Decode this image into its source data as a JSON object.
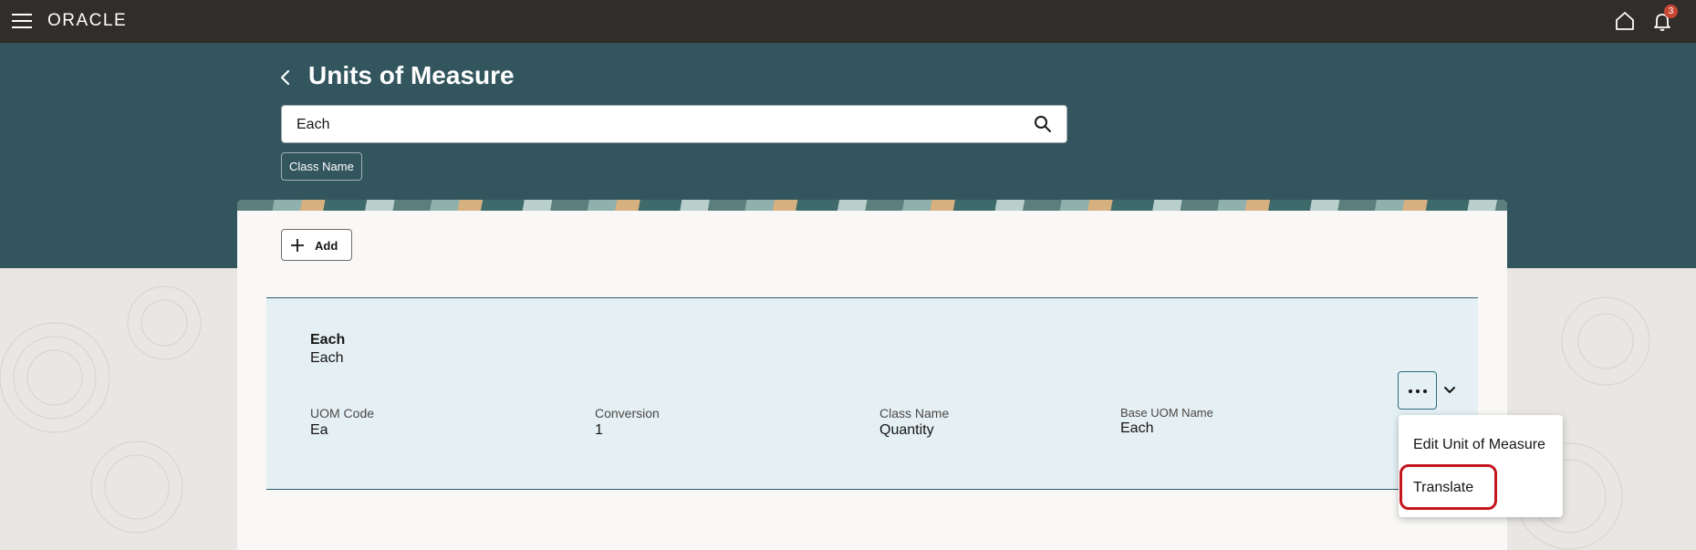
{
  "topbar": {
    "logo": "ORACLE",
    "notification_count": "3",
    "icons": [
      "menu-icon",
      "home-icon",
      "bell-icon"
    ]
  },
  "header": {
    "title": "Units of Measure"
  },
  "search": {
    "value": "Each"
  },
  "filters": {
    "chip_label": "Class Name"
  },
  "toolbar": {
    "add_label": "Add"
  },
  "record": {
    "title": "Each",
    "subtitle": "Each",
    "fields": [
      {
        "label": "UOM Code",
        "value": "Ea"
      },
      {
        "label": "Conversion",
        "value": "1"
      },
      {
        "label": "Class Name",
        "value": "Quantity"
      },
      {
        "label": "Base UOM Name",
        "value": "Each"
      }
    ]
  },
  "actions_menu": {
    "items": [
      "Edit Unit of Measure",
      "Translate"
    ],
    "highlighted": "Translate"
  },
  "colors": {
    "topbar": "#312d2a",
    "header": "#33555e",
    "row_bg": "#e4f0f4",
    "badge": "#c74634",
    "highlight": "#c5151f"
  }
}
